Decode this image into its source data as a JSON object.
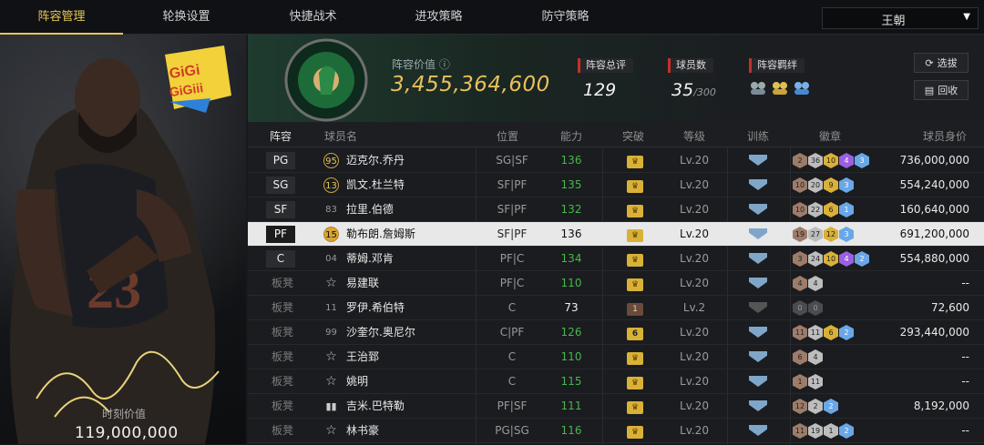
{
  "tabs": [
    {
      "label": "阵容管理",
      "active": true
    },
    {
      "label": "轮换设置"
    },
    {
      "label": "快捷战术"
    },
    {
      "label": "进攻策略"
    },
    {
      "label": "防守策略"
    }
  ],
  "dropdown": {
    "value": "王朝"
  },
  "card": {
    "worth_label": "时刻价值",
    "worth": "119,000,000",
    "logo_text": "GiGi GiGiGiii"
  },
  "summary": {
    "lineup_value_label": "阵容价值",
    "lineup_value": "3,455,364,600",
    "rating_label": "阵容总评",
    "rating": "129",
    "players_label": "球员数",
    "players": "35",
    "players_max": "/300",
    "bonds_label": "阵容羁绊",
    "btn_select": "选拔",
    "btn_recycle": "回收"
  },
  "headers": {
    "lineup": "阵容",
    "name": "球员名",
    "pos": "位置",
    "ability": "能力",
    "breakout": "突破",
    "level": "等级",
    "train": "训练",
    "badges": "徽章",
    "value": "球员身价"
  },
  "rows": [
    {
      "slot": "PG",
      "num": "95",
      "numtype": "gold",
      "name": "迈克尔.乔丹",
      "pos": "SG|SF",
      "ability": "136",
      "breakout": "crown",
      "level": "Lv.20",
      "badges": [
        [
          "b",
          "2"
        ],
        [
          "s",
          "36"
        ],
        [
          "g",
          "10"
        ],
        [
          "p",
          "4"
        ],
        [
          "bl",
          "3"
        ]
      ],
      "value": "736,000,000"
    },
    {
      "slot": "SG",
      "num": "13",
      "numtype": "gold",
      "name": "凯文.杜兰特",
      "pos": "SF|PF",
      "ability": "135",
      "breakout": "crown",
      "level": "Lv.20",
      "badges": [
        [
          "b",
          "10"
        ],
        [
          "s",
          "20"
        ],
        [
          "g",
          "9"
        ],
        [
          "bl",
          "3"
        ]
      ],
      "value": "554,240,000"
    },
    {
      "slot": "SF",
      "num": "83",
      "numtype": "plain",
      "name": "拉里.伯德",
      "pos": "SF|PF",
      "ability": "132",
      "breakout": "crown",
      "level": "Lv.20",
      "badges": [
        [
          "b",
          "10"
        ],
        [
          "s",
          "22"
        ],
        [
          "g",
          "6"
        ],
        [
          "bl",
          "1"
        ]
      ],
      "value": "160,640,000"
    },
    {
      "slot": "PF",
      "num": "15",
      "numtype": "gold",
      "name": "勒布朗.詹姆斯",
      "pos": "SF|PF",
      "ability": "136",
      "breakout": "crown",
      "level": "Lv.20",
      "badges": [
        [
          "b",
          "19"
        ],
        [
          "s",
          "27"
        ],
        [
          "g",
          "12"
        ],
        [
          "bl",
          "3"
        ]
      ],
      "value": "691,200,000",
      "selected": true
    },
    {
      "slot": "C",
      "num": "04",
      "numtype": "plain",
      "name": "蒂姆.邓肯",
      "pos": "PF|C",
      "ability": "134",
      "breakout": "crown",
      "level": "Lv.20",
      "badges": [
        [
          "b",
          "3"
        ],
        [
          "s",
          "24"
        ],
        [
          "g",
          "10"
        ],
        [
          "p",
          "4"
        ],
        [
          "bl",
          "2"
        ]
      ],
      "value": "554,880,000"
    },
    {
      "slot": "板凳",
      "num": "☆",
      "numtype": "star",
      "name": "易建联",
      "pos": "PF|C",
      "ability": "110",
      "breakout": "crown",
      "level": "Lv.20",
      "badges": [
        [
          "b",
          "4"
        ],
        [
          "s",
          "4"
        ]
      ],
      "value": "--"
    },
    {
      "slot": "板凳",
      "num": "11",
      "numtype": "plain",
      "name": "罗伊.希伯特",
      "pos": "C",
      "ability": "73",
      "abilitywhite": true,
      "breakout": "1",
      "level": "Lv.2",
      "traingrey": true,
      "badges": [
        [
          "dark",
          "0"
        ],
        [
          "dark",
          "0"
        ]
      ],
      "value": "72,600"
    },
    {
      "slot": "板凳",
      "num": "99",
      "numtype": "plain",
      "name": "沙奎尔.奥尼尔",
      "pos": "C|PF",
      "ability": "126",
      "breakout": "6",
      "level": "Lv.20",
      "badges": [
        [
          "b",
          "11"
        ],
        [
          "s",
          "11"
        ],
        [
          "g",
          "6"
        ],
        [
          "bl",
          "2"
        ]
      ],
      "value": "293,440,000"
    },
    {
      "slot": "板凳",
      "num": "☆",
      "numtype": "star",
      "name": "王治郅",
      "pos": "C",
      "ability": "110",
      "breakout": "crown",
      "level": "Lv.20",
      "badges": [
        [
          "b",
          "6"
        ],
        [
          "s",
          "4"
        ]
      ],
      "value": "--"
    },
    {
      "slot": "板凳",
      "num": "☆",
      "numtype": "star",
      "name": "姚明",
      "pos": "C",
      "ability": "115",
      "breakout": "crown",
      "level": "Lv.20",
      "badges": [
        [
          "b",
          "1"
        ],
        [
          "s",
          "11"
        ]
      ],
      "value": "--"
    },
    {
      "slot": "板凳",
      "num": "▮▮",
      "numtype": "bars",
      "name": "吉米.巴特勒",
      "pos": "PF|SF",
      "ability": "111",
      "breakout": "crown",
      "level": "Lv.20",
      "badges": [
        [
          "b",
          "12"
        ],
        [
          "s",
          "2"
        ],
        [
          "bl",
          "2"
        ]
      ],
      "value": "8,192,000"
    },
    {
      "slot": "板凳",
      "num": "☆",
      "numtype": "star",
      "name": "林书豪",
      "pos": "PG|SG",
      "ability": "116",
      "breakout": "crown",
      "level": "Lv.20",
      "badges": [
        [
          "b",
          "11"
        ],
        [
          "s",
          "19"
        ],
        [
          "s",
          "1"
        ],
        [
          "bl",
          "2"
        ]
      ],
      "value": "--"
    }
  ]
}
